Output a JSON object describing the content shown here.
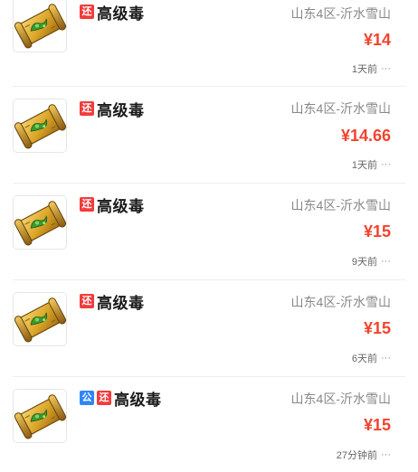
{
  "listings": [
    {
      "tags": [
        {
          "text": "还",
          "color": "#f23b3b"
        }
      ],
      "title": "高级毒",
      "server": "山东4区-沂水雪山",
      "price": "¥14",
      "time": "1天前",
      "more": "···"
    },
    {
      "tags": [
        {
          "text": "还",
          "color": "#f23b3b"
        }
      ],
      "title": "高级毒",
      "server": "山东4区-沂水雪山",
      "price": "¥14.66",
      "time": "1天前",
      "more": "···"
    },
    {
      "tags": [
        {
          "text": "还",
          "color": "#f23b3b"
        }
      ],
      "title": "高级毒",
      "server": "山东4区-沂水雪山",
      "price": "¥15",
      "time": "9天前",
      "more": "···"
    },
    {
      "tags": [
        {
          "text": "还",
          "color": "#f23b3b"
        }
      ],
      "title": "高级毒",
      "server": "山东4区-沂水雪山",
      "price": "¥15",
      "time": "6天前",
      "more": "···"
    },
    {
      "tags": [
        {
          "text": "公",
          "color": "#2f86f6"
        },
        {
          "text": "还",
          "color": "#f23b3b"
        }
      ],
      "title": "高级毒",
      "server": "山东4区-沂水雪山",
      "price": "¥15",
      "time": "27分钟前",
      "more": "···"
    }
  ],
  "icons": {
    "item_image": "poison-scroll-icon",
    "more": "more-icon"
  },
  "colors": {
    "price": "#f2432f",
    "tag_return": "#f23b3b",
    "tag_public": "#2f86f6"
  }
}
